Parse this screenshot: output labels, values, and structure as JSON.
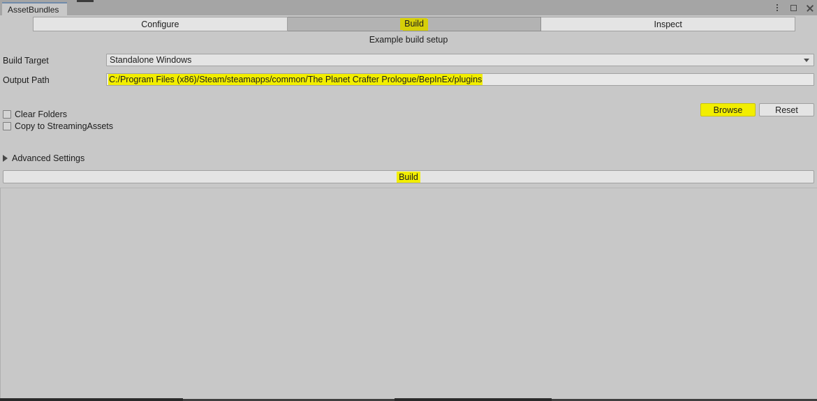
{
  "window": {
    "tab_title": "AssetBundles",
    "controls": {
      "menu": "kebab-menu-icon",
      "maximize": "maximize-icon",
      "close": "close-icon"
    }
  },
  "toolbar": {
    "tabs": [
      {
        "label": "Configure",
        "selected": false
      },
      {
        "label": "Build",
        "selected": true,
        "highlighted": true
      },
      {
        "label": "Inspect",
        "selected": false
      }
    ]
  },
  "main": {
    "subtitle": "Example build setup",
    "build_target": {
      "label": "Build Target",
      "value": "Standalone Windows",
      "caret": "chevron-down-icon"
    },
    "output_path": {
      "label": "Output Path",
      "value": "C:/Program Files (x86)/Steam/steamapps/common/The Planet Crafter Prologue/BepInEx/plugins",
      "highlighted": true
    },
    "buttons": {
      "browse": "Browse",
      "browse_highlighted": true,
      "reset": "Reset"
    },
    "checkboxes": [
      {
        "label": "Clear Folders",
        "checked": false
      },
      {
        "label": "Copy to StreamingAssets",
        "checked": false
      }
    ],
    "foldout": {
      "label": "Advanced Settings",
      "expanded": false,
      "icon": "triangle-right-icon"
    },
    "build_button": {
      "label": "Build",
      "highlighted": true
    }
  },
  "colors": {
    "window_bg": "#c8c8c8",
    "titlebar_bg": "#a5a5a5",
    "field_bg": "#e4e4e4",
    "selected_tab_bg": "#b3b3b3",
    "tab_accent": "#6f8aaa",
    "highlight_yellow": "#f2ee00",
    "highlight_yellow_dull": "#d6cf08",
    "text": "#1c1c1c"
  }
}
